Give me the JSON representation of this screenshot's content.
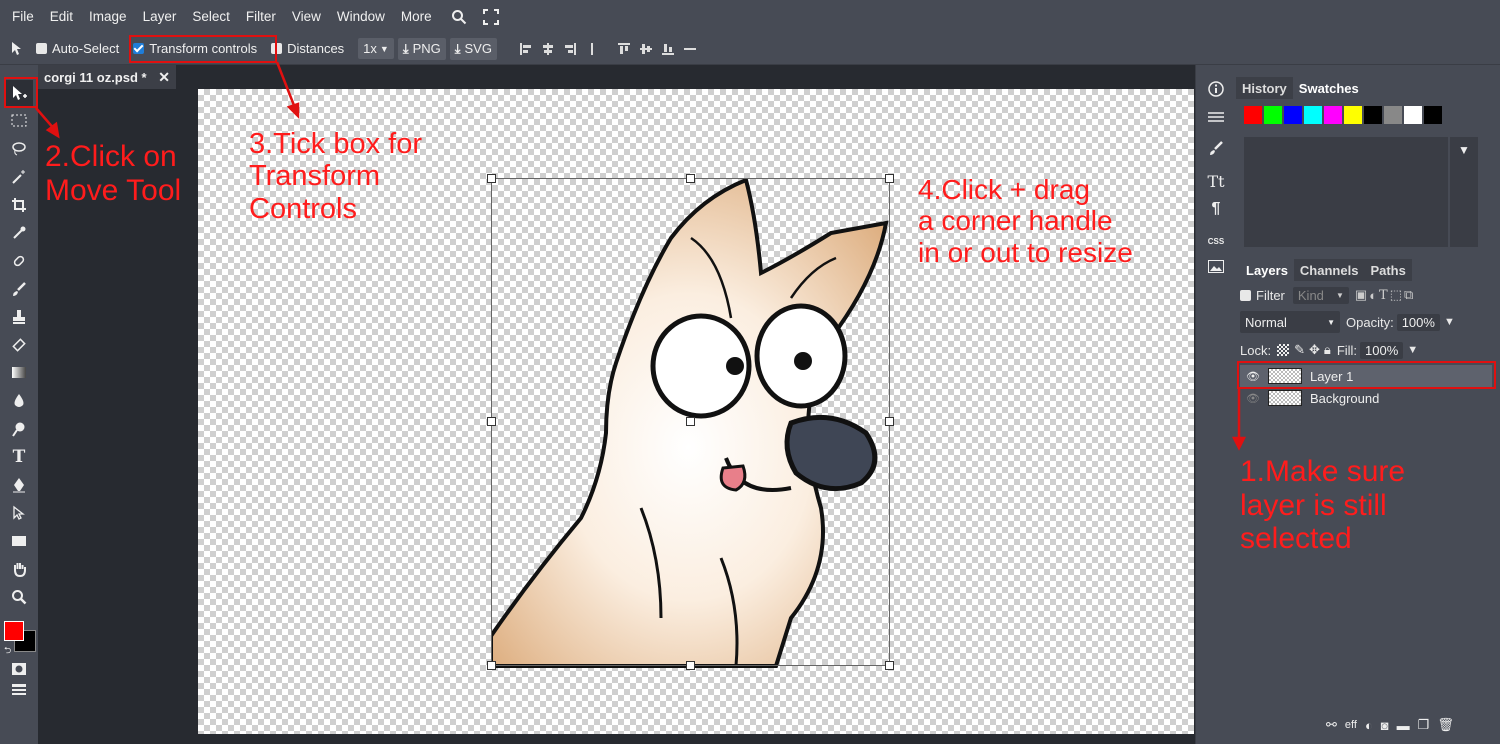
{
  "menubar": {
    "items": [
      "File",
      "Edit",
      "Image",
      "Layer",
      "Select",
      "Filter",
      "View",
      "Window",
      "More"
    ],
    "icons": [
      "search-icon",
      "fullscreen-icon"
    ]
  },
  "options": {
    "auto_select": "Auto-Select",
    "transform_controls": "Transform controls",
    "distances": "Distances",
    "zoom": "1x",
    "png": "PNG",
    "svg": "SVG"
  },
  "collapse_glyph": "><",
  "strip_glyph": "<>",
  "document_tab": {
    "title": "corgi 11 oz.psd *",
    "close": "✕"
  },
  "right_panel": {
    "top_tabs": [
      "History",
      "Swatches"
    ],
    "swatches": [
      "#ff0000",
      "#00ff00",
      "#0000ff",
      "#00ffff",
      "#ff00ff",
      "#ffff00",
      "#000000",
      "#888888",
      "#ffffff",
      "#000000"
    ],
    "layer_tabs": [
      "Layers",
      "Channels",
      "Paths"
    ],
    "filter_label": "Filter",
    "kind_label": "Kind",
    "blend_mode": "Normal",
    "opacity_label": "Opacity:",
    "opacity_value": "100%",
    "lock_label": "Lock:",
    "fill_label": "Fill:",
    "fill_value": "100%",
    "layers": [
      {
        "name": "Layer 1",
        "selected": true
      },
      {
        "name": "Background",
        "selected": false
      }
    ],
    "footer_eff": "eff"
  },
  "annotations": {
    "step1": [
      "1.Make sure",
      "layer is still",
      "selected"
    ],
    "step2": [
      "2.Click on",
      "Move Tool"
    ],
    "step3": [
      "3.Tick box for",
      "Transform",
      "Controls"
    ],
    "step4": [
      "4.Click + drag",
      "a corner handle",
      "in or out to resize"
    ]
  },
  "colors": {
    "foreground": "#ff0000",
    "background": "#000000",
    "annotation": "#ff1c1c",
    "accent": "#1f7dd8"
  }
}
